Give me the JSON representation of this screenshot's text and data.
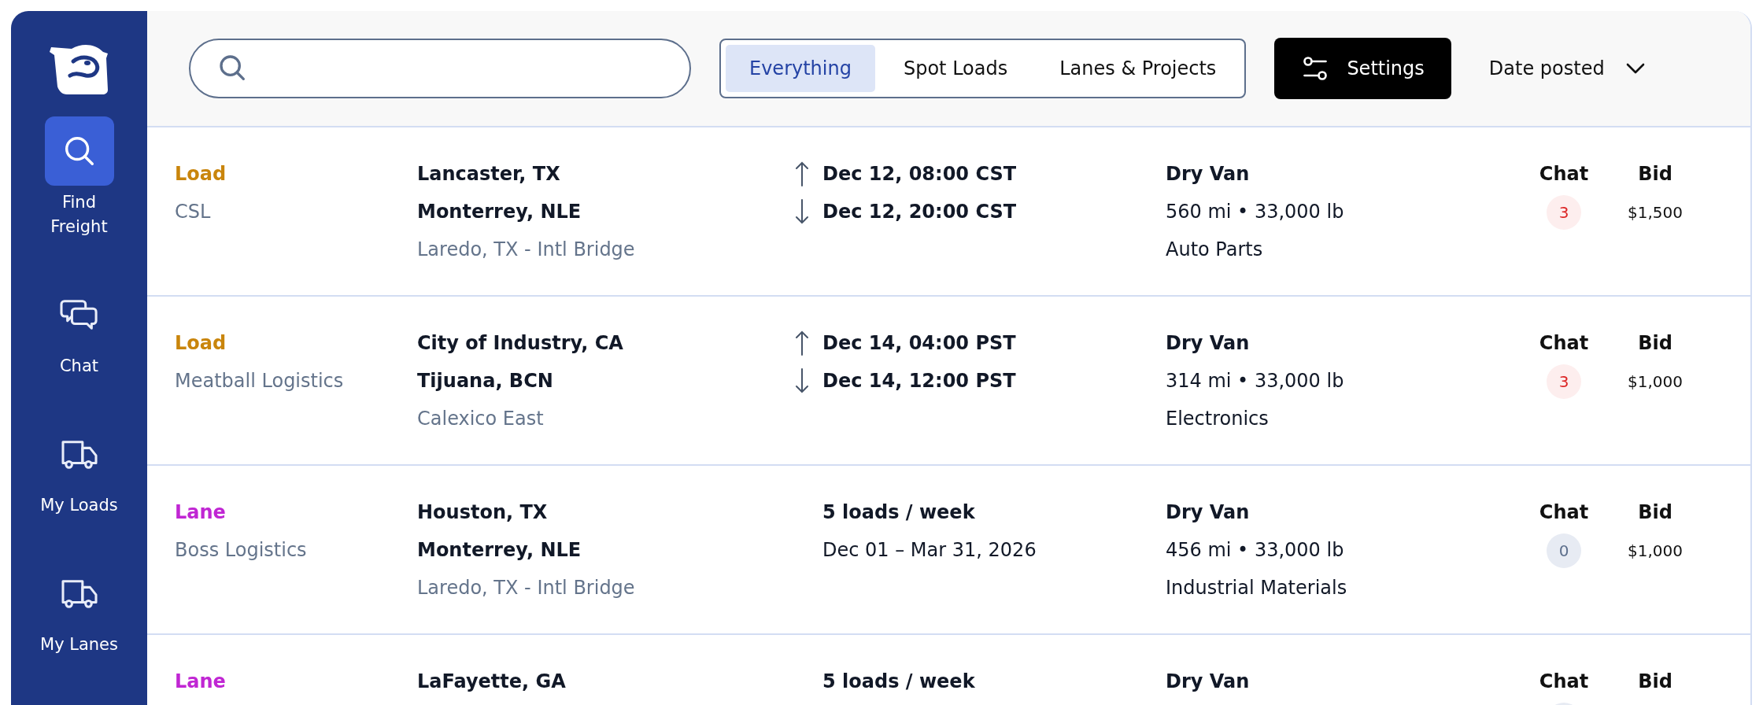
{
  "sidebar": {
    "items": [
      {
        "label": "Find Freight",
        "kind": "search",
        "selected": true
      },
      {
        "label": "Chat",
        "kind": "chat",
        "selected": false
      },
      {
        "label": "My Loads",
        "kind": "loads",
        "selected": false
      },
      {
        "label": "My Lanes",
        "kind": "lanes",
        "selected": false
      }
    ]
  },
  "toolbar": {
    "tabs": [
      {
        "label": "Everything",
        "selected": true
      },
      {
        "label": "Spot Loads",
        "selected": false
      },
      {
        "label": "Lanes & Projects",
        "selected": false
      }
    ],
    "settings_button": "Settings",
    "sort": "Date posted"
  },
  "rows": [
    {
      "kind": "load",
      "type": "Load",
      "company": "CSL",
      "origin": "Lancaster, TX",
      "destination": "Monterrey, NLE",
      "crossing": "Laredo, TX - Intl Bridge",
      "schedule_1": "Dec 12, 08:00 CST",
      "schedule_2": "Dec 12, 20:00 CST",
      "equipment": "Dry Van",
      "distance": "560 mi • 33,000 lb",
      "commodity": "Auto Parts",
      "chat_label": "Chat",
      "chat_count": "3",
      "chat_unread": true,
      "bid_label": "Bid",
      "bid": "$1,500"
    },
    {
      "kind": "load",
      "type": "Load",
      "company": "Meatball Logistics",
      "origin": "City of Industry, CA",
      "destination": "Tijuana, BCN",
      "crossing": "Calexico East",
      "schedule_1": "Dec 14, 04:00 PST",
      "schedule_2": "Dec 14, 12:00 PST",
      "equipment": "Dry Van",
      "distance": "314 mi • 33,000 lb",
      "commodity": "Electronics",
      "chat_label": "Chat",
      "chat_count": "3",
      "chat_unread": true,
      "bid_label": "Bid",
      "bid": "$1,000"
    },
    {
      "kind": "lane",
      "type": "Lane",
      "company": "Boss Logistics",
      "origin": "Houston, TX",
      "destination": "Monterrey, NLE",
      "crossing": "Laredo, TX - Intl Bridge",
      "schedule_1": "5 loads / week",
      "schedule_2": "Dec 01 – Mar 31, 2026",
      "equipment": "Dry Van",
      "distance": "456 mi • 33,000 lb",
      "commodity": "Industrial Materials",
      "chat_label": "Chat",
      "chat_count": "0",
      "chat_unread": false,
      "bid_label": "Bid",
      "bid": "$1,000"
    },
    {
      "kind": "lane",
      "type": "Lane",
      "origin": "LaFayette, GA",
      "schedule_1": "5 loads / week",
      "equipment": "Dry Van",
      "chat_label": "Chat",
      "chat_unread": false,
      "bid_label": "Bid"
    }
  ]
}
